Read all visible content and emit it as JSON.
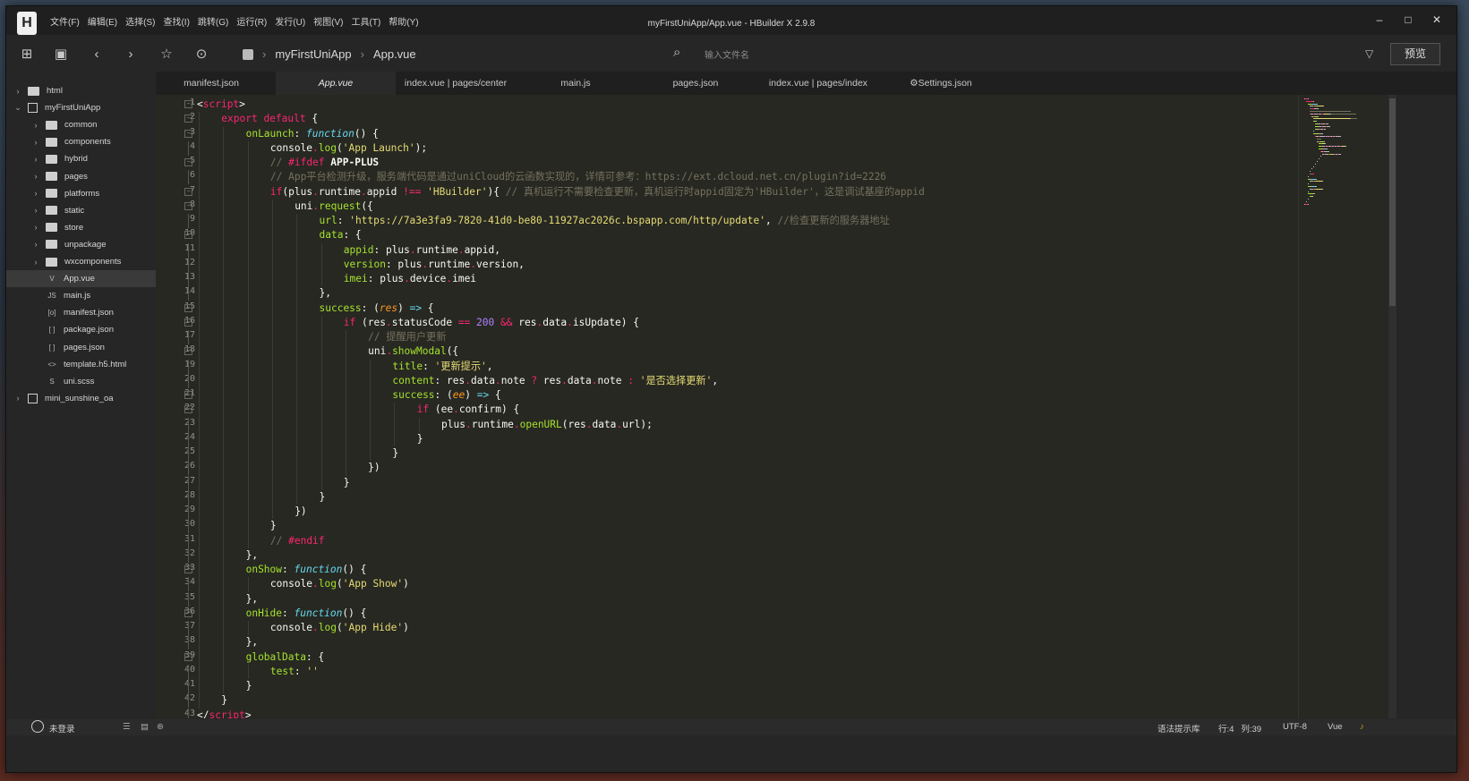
{
  "window": {
    "title": "myFirstUniApp/App.vue - HBuilder X 2.9.8",
    "logo_letter": "H",
    "controls": [
      "–",
      "□",
      "✕"
    ]
  },
  "menu": [
    "文件(F)",
    "编辑(E)",
    "选择(S)",
    "查找(I)",
    "跳转(G)",
    "运行(R)",
    "发行(U)",
    "视图(V)",
    "工具(T)",
    "帮助(Y)"
  ],
  "toolbar": {
    "breadcrumb": [
      "myFirstUniApp",
      "App.vue"
    ],
    "search_placeholder": "输入文件名",
    "preview_label": "预览"
  },
  "sidebar": {
    "items": [
      {
        "label": "html",
        "type": "folder",
        "level": 0,
        "expanded": false
      },
      {
        "label": "myFirstUniApp",
        "type": "project",
        "level": 0,
        "expanded": true
      },
      {
        "label": "common",
        "type": "folder",
        "level": 1,
        "expanded": false
      },
      {
        "label": "components",
        "type": "folder",
        "level": 1,
        "expanded": false
      },
      {
        "label": "hybrid",
        "type": "folder",
        "level": 1,
        "expanded": false
      },
      {
        "label": "pages",
        "type": "folder",
        "level": 1,
        "expanded": false
      },
      {
        "label": "platforms",
        "type": "folder",
        "level": 1,
        "expanded": false
      },
      {
        "label": "static",
        "type": "folder",
        "level": 1,
        "expanded": false
      },
      {
        "label": "store",
        "type": "folder",
        "level": 1,
        "expanded": false
      },
      {
        "label": "unpackage",
        "type": "folder",
        "level": 1,
        "expanded": false
      },
      {
        "label": "wxcomponents",
        "type": "folder",
        "level": 1,
        "expanded": false
      },
      {
        "label": "App.vue",
        "type": "file",
        "icon": "V",
        "level": 1,
        "active": true
      },
      {
        "label": "main.js",
        "type": "file",
        "icon": "JS",
        "level": 1
      },
      {
        "label": "manifest.json",
        "type": "file",
        "icon": "[o]",
        "level": 1
      },
      {
        "label": "package.json",
        "type": "file",
        "icon": "[ ]",
        "level": 1
      },
      {
        "label": "pages.json",
        "type": "file",
        "icon": "[ ]",
        "level": 1
      },
      {
        "label": "template.h5.html",
        "type": "file",
        "icon": "<>",
        "level": 1
      },
      {
        "label": "uni.scss",
        "type": "file",
        "icon": "S",
        "level": 1
      },
      {
        "label": "mini_sunshine_oa",
        "type": "project",
        "level": 0,
        "expanded": false
      }
    ]
  },
  "tabs": [
    {
      "label": "manifest.json"
    },
    {
      "label": "App.vue",
      "active": true
    },
    {
      "label": "index.vue | pages/center"
    },
    {
      "label": "main.js"
    },
    {
      "label": "pages.json"
    },
    {
      "label": "index.vue | pages/index"
    },
    {
      "label": "Settings.json",
      "icon": "gear-icon"
    }
  ],
  "editor": {
    "lines": [
      {
        "n": 1,
        "fold": true,
        "indent": 0,
        "t": [
          [
            "<",
            "w"
          ],
          [
            "script",
            "k"
          ],
          [
            ">",
            "w"
          ]
        ]
      },
      {
        "n": 2,
        "fold": true,
        "indent": 1,
        "t": [
          [
            "export default",
            "k"
          ],
          [
            " {",
            "w"
          ]
        ]
      },
      {
        "n": 3,
        "fold": true,
        "indent": 2,
        "t": [
          [
            "onLaunch",
            "g"
          ],
          [
            ": ",
            "w"
          ],
          [
            "function",
            "f"
          ],
          [
            "() {",
            "w"
          ]
        ]
      },
      {
        "n": 4,
        "indent": 3,
        "t": [
          [
            "console",
            "w"
          ],
          [
            ".",
            "k"
          ],
          [
            "log",
            "g"
          ],
          [
            "(",
            "w"
          ],
          [
            "'App Launch'",
            "s"
          ],
          [
            ");",
            "w"
          ]
        ]
      },
      {
        "n": 5,
        "fold": true,
        "indent": 3,
        "t": [
          [
            "// ",
            "c"
          ],
          [
            "#ifdef",
            "k"
          ],
          [
            " ",
            "w"
          ],
          [
            "APP-PLUS",
            "wb"
          ]
        ]
      },
      {
        "n": 6,
        "indent": 3,
        "t": [
          [
            "// App平台检测升级，服务端代码是通过uniCloud的云函数实现的，详情可参考：https://ext.dcloud.net.cn/plugin?id=2226",
            "c"
          ]
        ]
      },
      {
        "n": 7,
        "fold": true,
        "indent": 3,
        "t": [
          [
            "if",
            "k"
          ],
          [
            "(plus",
            "w"
          ],
          [
            ".",
            "k"
          ],
          [
            "runtime",
            "w"
          ],
          [
            ".",
            "k"
          ],
          [
            "appid ",
            "w"
          ],
          [
            "!==",
            "k"
          ],
          [
            " ",
            "w"
          ],
          [
            "'HBuilder'",
            "s"
          ],
          [
            "){ ",
            "w"
          ],
          [
            "// 真机运行不需要检查更新，真机运行时appid固定为'HBuilder'，这是调试基座的appid",
            "c"
          ]
        ]
      },
      {
        "n": 8,
        "fold": true,
        "indent": 4,
        "t": [
          [
            "uni",
            "w"
          ],
          [
            ".",
            "k"
          ],
          [
            "request",
            "g"
          ],
          [
            "({",
            "w"
          ]
        ]
      },
      {
        "n": 9,
        "indent": 5,
        "t": [
          [
            "url",
            "g"
          ],
          [
            ": ",
            "w"
          ],
          [
            "'https://7a3e3fa9-7820-41d0-be80-11927ac2026c.bspapp.com/http/update'",
            "s"
          ],
          [
            ", ",
            "w"
          ],
          [
            "//检查更新的服务器地址",
            "c"
          ]
        ]
      },
      {
        "n": 10,
        "fold": true,
        "indent": 5,
        "t": [
          [
            "data",
            "g"
          ],
          [
            ": {",
            "w"
          ]
        ]
      },
      {
        "n": 11,
        "indent": 6,
        "t": [
          [
            "appid",
            "g"
          ],
          [
            ": plus",
            "w"
          ],
          [
            ".",
            "k"
          ],
          [
            "runtime",
            "w"
          ],
          [
            ".",
            "k"
          ],
          [
            "appid,",
            "w"
          ]
        ]
      },
      {
        "n": 12,
        "indent": 6,
        "t": [
          [
            "version",
            "g"
          ],
          [
            ": plus",
            "w"
          ],
          [
            ".",
            "k"
          ],
          [
            "runtime",
            "w"
          ],
          [
            ".",
            "k"
          ],
          [
            "version,",
            "w"
          ]
        ]
      },
      {
        "n": 13,
        "indent": 6,
        "t": [
          [
            "imei",
            "g"
          ],
          [
            ": plus",
            "w"
          ],
          [
            ".",
            "k"
          ],
          [
            "device",
            "w"
          ],
          [
            ".",
            "k"
          ],
          [
            "imei",
            "w"
          ]
        ]
      },
      {
        "n": 14,
        "indent": 5,
        "t": [
          [
            "},",
            "w"
          ]
        ]
      },
      {
        "n": 15,
        "fold": true,
        "indent": 5,
        "t": [
          [
            "success",
            "g"
          ],
          [
            ": (",
            "w"
          ],
          [
            "res",
            "p"
          ],
          [
            ") ",
            "w"
          ],
          [
            "=>",
            "f"
          ],
          [
            " {",
            "w"
          ]
        ]
      },
      {
        "n": 16,
        "fold": true,
        "indent": 6,
        "t": [
          [
            "if",
            "k"
          ],
          [
            " (res",
            "w"
          ],
          [
            ".",
            "k"
          ],
          [
            "statusCode ",
            "w"
          ],
          [
            "==",
            "k"
          ],
          [
            " ",
            "w"
          ],
          [
            "200",
            "n"
          ],
          [
            " ",
            "w"
          ],
          [
            "&&",
            "k"
          ],
          [
            " res",
            "w"
          ],
          [
            ".",
            "k"
          ],
          [
            "data",
            "w"
          ],
          [
            ".",
            "k"
          ],
          [
            "isUpdate) {",
            "w"
          ]
        ]
      },
      {
        "n": 17,
        "indent": 7,
        "t": [
          [
            "// 提醒用户更新",
            "c"
          ]
        ]
      },
      {
        "n": 18,
        "fold": true,
        "indent": 7,
        "t": [
          [
            "uni",
            "w"
          ],
          [
            ".",
            "k"
          ],
          [
            "showModal",
            "g"
          ],
          [
            "({",
            "w"
          ]
        ]
      },
      {
        "n": 19,
        "indent": 8,
        "t": [
          [
            "title",
            "g"
          ],
          [
            ": ",
            "w"
          ],
          [
            "'更新提示'",
            "s"
          ],
          [
            ",",
            "w"
          ]
        ]
      },
      {
        "n": 20,
        "indent": 8,
        "t": [
          [
            "content",
            "g"
          ],
          [
            ": res",
            "w"
          ],
          [
            ".",
            "k"
          ],
          [
            "data",
            "w"
          ],
          [
            ".",
            "k"
          ],
          [
            "note ",
            "w"
          ],
          [
            "?",
            "k"
          ],
          [
            " res",
            "w"
          ],
          [
            ".",
            "k"
          ],
          [
            "data",
            "w"
          ],
          [
            ".",
            "k"
          ],
          [
            "note ",
            "w"
          ],
          [
            ":",
            "k"
          ],
          [
            " ",
            "w"
          ],
          [
            "'是否选择更新'",
            "s"
          ],
          [
            ",",
            "w"
          ]
        ]
      },
      {
        "n": 21,
        "fold": true,
        "indent": 8,
        "t": [
          [
            "success",
            "g"
          ],
          [
            ": (",
            "w"
          ],
          [
            "ee",
            "p"
          ],
          [
            ") ",
            "w"
          ],
          [
            "=>",
            "f"
          ],
          [
            " {",
            "w"
          ]
        ]
      },
      {
        "n": 22,
        "fold": true,
        "indent": 9,
        "t": [
          [
            "if",
            "k"
          ],
          [
            " (ee",
            "w"
          ],
          [
            ".",
            "k"
          ],
          [
            "confirm) {",
            "w"
          ]
        ]
      },
      {
        "n": 23,
        "indent": 10,
        "t": [
          [
            "plus",
            "w"
          ],
          [
            ".",
            "k"
          ],
          [
            "runtime",
            "w"
          ],
          [
            ".",
            "k"
          ],
          [
            "openURL",
            "g"
          ],
          [
            "(res",
            "w"
          ],
          [
            ".",
            "k"
          ],
          [
            "data",
            "w"
          ],
          [
            ".",
            "k"
          ],
          [
            "url);",
            "w"
          ]
        ]
      },
      {
        "n": 24,
        "indent": 9,
        "t": [
          [
            "}",
            "w"
          ]
        ]
      },
      {
        "n": 25,
        "indent": 8,
        "t": [
          [
            "}",
            "w"
          ]
        ]
      },
      {
        "n": 26,
        "indent": 7,
        "t": [
          [
            "})",
            "w"
          ]
        ]
      },
      {
        "n": 27,
        "indent": 6,
        "t": [
          [
            "}",
            "w"
          ]
        ]
      },
      {
        "n": 28,
        "indent": 5,
        "t": [
          [
            "}",
            "w"
          ]
        ]
      },
      {
        "n": 29,
        "indent": 4,
        "t": [
          [
            "})",
            "w"
          ]
        ]
      },
      {
        "n": 30,
        "indent": 3,
        "t": [
          [
            "}",
            "w"
          ]
        ]
      },
      {
        "n": 31,
        "indent": 3,
        "t": [
          [
            "// ",
            "c"
          ],
          [
            "#endif",
            "k"
          ]
        ]
      },
      {
        "n": 32,
        "indent": 2,
        "t": [
          [
            "},",
            "w"
          ]
        ]
      },
      {
        "n": 33,
        "fold": true,
        "indent": 2,
        "t": [
          [
            "onShow",
            "g"
          ],
          [
            ": ",
            "w"
          ],
          [
            "function",
            "f"
          ],
          [
            "() {",
            "w"
          ]
        ]
      },
      {
        "n": 34,
        "indent": 3,
        "t": [
          [
            "console",
            "w"
          ],
          [
            ".",
            "k"
          ],
          [
            "log",
            "g"
          ],
          [
            "(",
            "w"
          ],
          [
            "'App Show'",
            "s"
          ],
          [
            ")",
            "w"
          ]
        ]
      },
      {
        "n": 35,
        "indent": 2,
        "t": [
          [
            "},",
            "w"
          ]
        ]
      },
      {
        "n": 36,
        "fold": true,
        "indent": 2,
        "t": [
          [
            "onHide",
            "g"
          ],
          [
            ": ",
            "w"
          ],
          [
            "function",
            "f"
          ],
          [
            "() {",
            "w"
          ]
        ]
      },
      {
        "n": 37,
        "indent": 3,
        "t": [
          [
            "console",
            "w"
          ],
          [
            ".",
            "k"
          ],
          [
            "log",
            "g"
          ],
          [
            "(",
            "w"
          ],
          [
            "'App Hide'",
            "s"
          ],
          [
            ")",
            "w"
          ]
        ]
      },
      {
        "n": 38,
        "indent": 2,
        "t": [
          [
            "},",
            "w"
          ]
        ]
      },
      {
        "n": 39,
        "fold": true,
        "indent": 2,
        "t": [
          [
            "globalData",
            "g"
          ],
          [
            ": {",
            "w"
          ]
        ]
      },
      {
        "n": 40,
        "indent": 3,
        "t": [
          [
            "test",
            "g"
          ],
          [
            ": ",
            "w"
          ],
          [
            "''",
            "s"
          ]
        ]
      },
      {
        "n": 41,
        "indent": 2,
        "t": [
          [
            "}",
            "w"
          ]
        ]
      },
      {
        "n": 42,
        "indent": 1,
        "t": [
          [
            "}",
            "w"
          ]
        ]
      },
      {
        "n": 43,
        "indent": 0,
        "t": [
          [
            "</",
            "w"
          ],
          [
            "script",
            "k"
          ],
          [
            ">",
            "w"
          ]
        ]
      }
    ]
  },
  "statusbar": {
    "user": "未登录",
    "hint": "语法提示库",
    "position": "行:4   列:39",
    "encoding": "UTF-8",
    "language": "Vue"
  },
  "colors": {
    "keyword": "#f92672",
    "string": "#e6db74",
    "comment": "#75715e",
    "function": "#a6e22e",
    "number": "#ae81ff",
    "storage": "#66d9ef",
    "param": "#fd971f"
  }
}
